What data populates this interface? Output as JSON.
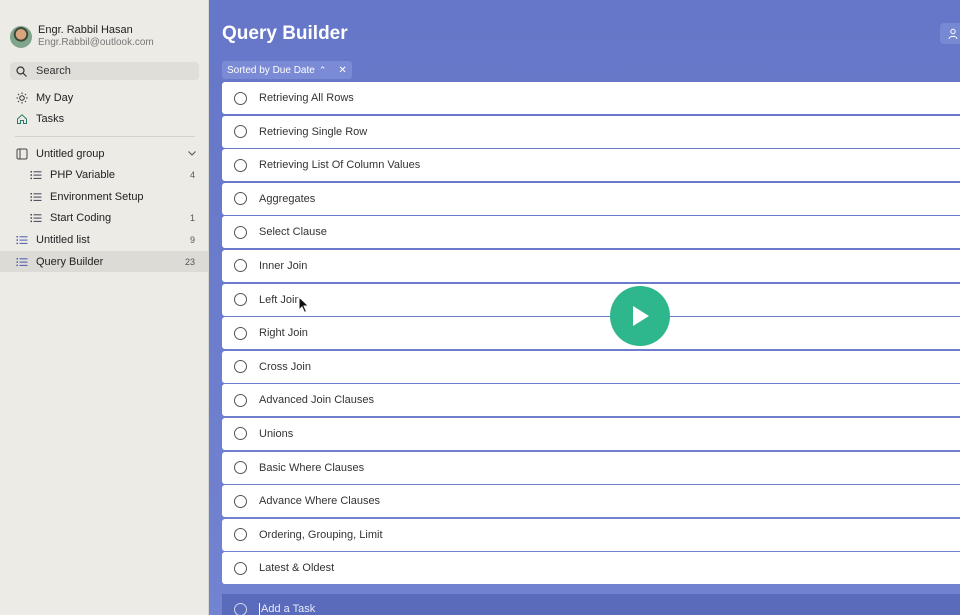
{
  "profile": {
    "name": "Engr. Rabbil Hasan",
    "email": "Engr.Rabbil@outlook.com"
  },
  "search": {
    "label": "Search"
  },
  "nav": {
    "my_day": "My Day",
    "tasks": "Tasks",
    "group": {
      "label": "Untitled group"
    },
    "group_lists": [
      {
        "label": "PHP Variable",
        "count": "4"
      },
      {
        "label": "Environment Setup",
        "count": ""
      },
      {
        "label": "Start Coding",
        "count": "1"
      }
    ],
    "lists": [
      {
        "label": "Untitled list",
        "count": "9"
      },
      {
        "label": "Query Builder",
        "count": "23"
      }
    ]
  },
  "main": {
    "title": "Query Builder",
    "sort": {
      "label": "Sorted by Due Date"
    },
    "tasks": [
      "Retrieving  All Rows",
      "Retrieving  Single Row",
      "Retrieving  List Of Column Values",
      "Aggregates",
      "Select Clause",
      "Inner Join",
      "Left Join",
      "Right Join",
      "Cross Join",
      "Advanced Join Clauses",
      "Unions",
      "Basic Where Clauses",
      "Advance Where Clauses",
      "Ordering, Grouping, Limit",
      "Latest & Oldest"
    ],
    "add_task": "Add a Task"
  },
  "colors": {
    "accent": "#6676c8",
    "play": "#2eb68c",
    "sidebar": "#ecebe6"
  }
}
